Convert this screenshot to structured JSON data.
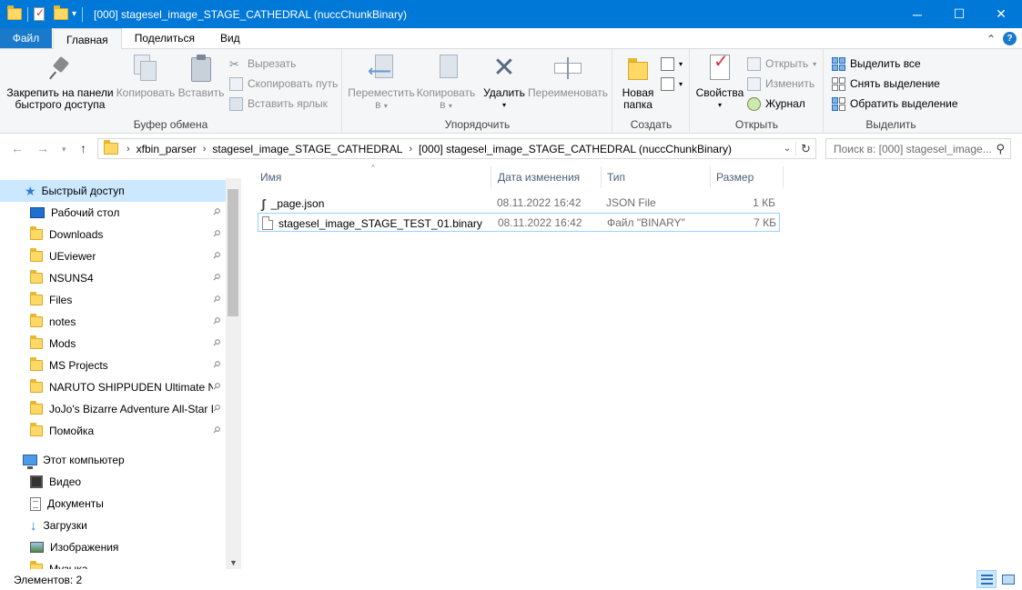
{
  "window": {
    "title": "[000] stagesel_image_STAGE_CATHEDRAL (nuccChunkBinary)",
    "minimize": "─",
    "maximize": "☐",
    "close": "✕"
  },
  "ribbon_tabs": [
    {
      "label": "Файл"
    },
    {
      "label": "Главная"
    },
    {
      "label": "Поделиться"
    },
    {
      "label": "Вид"
    }
  ],
  "ribbon": {
    "clipboard": {
      "label": "Буфер обмена",
      "pin_line1": "Закрепить на панели",
      "pin_line2": "быстрого доступа",
      "copy": "Копировать",
      "paste": "Вставить",
      "cut": "Вырезать",
      "copy_path": "Скопировать путь",
      "paste_shortcut": "Вставить ярлык"
    },
    "organize": {
      "label": "Упорядочить",
      "move_line1": "Переместить",
      "move_line2": "в",
      "copy_line1": "Копировать",
      "copy_line2": "в",
      "delete": "Удалить",
      "rename": "Переименовать"
    },
    "new": {
      "label": "Создать",
      "new_folder_line1": "Новая",
      "new_folder_line2": "папка"
    },
    "open": {
      "label": "Открыть",
      "properties": "Свойства",
      "open": "Открыть",
      "edit": "Изменить",
      "history": "Журнал"
    },
    "select": {
      "label": "Выделить",
      "select_all": "Выделить все",
      "select_none": "Снять выделение",
      "invert": "Обратить выделение"
    }
  },
  "address": {
    "crumbs": [
      "xfbin_parser",
      "stagesel_image_STAGE_CATHEDRAL",
      "[000] stagesel_image_STAGE_CATHEDRAL (nuccChunkBinary)"
    ],
    "search_placeholder": "Поиск в: [000] stagesel_image..."
  },
  "nav": {
    "quick_access": "Быстрый доступ",
    "pinned": [
      {
        "label": "Рабочий стол",
        "icon": "desktop-icon"
      },
      {
        "label": "Downloads",
        "icon": "folder-icon"
      },
      {
        "label": "UEviewer",
        "icon": "folder-icon"
      },
      {
        "label": "NSUNS4",
        "icon": "folder-icon"
      },
      {
        "label": "Files",
        "icon": "folder-icon"
      },
      {
        "label": "notes",
        "icon": "folder-icon"
      },
      {
        "label": "Mods",
        "icon": "folder-icon"
      },
      {
        "label": "MS Projects",
        "icon": "folder-icon"
      },
      {
        "label": "NARUTO SHIPPUDEN Ultimate Nii",
        "icon": "folder-icon"
      },
      {
        "label": "JoJo's Bizarre Adventure All-Star B",
        "icon": "folder-icon"
      },
      {
        "label": "Помойка",
        "icon": "folder-icon"
      }
    ],
    "this_pc": "Этот компьютер",
    "pc_items": [
      {
        "label": "Видео",
        "icon": "video-icon"
      },
      {
        "label": "Документы",
        "icon": "documents-icon"
      },
      {
        "label": "Загрузки",
        "icon": "downloads-icon"
      },
      {
        "label": "Изображения",
        "icon": "pictures-icon"
      },
      {
        "label": "Музыка",
        "icon": "music-icon"
      }
    ]
  },
  "filelist": {
    "columns": [
      "Имя",
      "Дата изменения",
      "Тип",
      "Размер"
    ],
    "rows": [
      {
        "name": "_page.json",
        "date": "08.11.2022 16:42",
        "type": "JSON File",
        "size": "1 КБ",
        "icon": "script-icon"
      },
      {
        "name": "stagesel_image_STAGE_TEST_01.binary",
        "date": "08.11.2022 16:42",
        "type": "Файл \"BINARY\"",
        "size": "7 КБ",
        "icon": "file-icon"
      }
    ]
  },
  "status": {
    "items_count": "Элементов: 2"
  },
  "colors": {
    "titlebar": "#0078d7",
    "file_tab": "#1979ca",
    "selection": "#cce8ff"
  }
}
